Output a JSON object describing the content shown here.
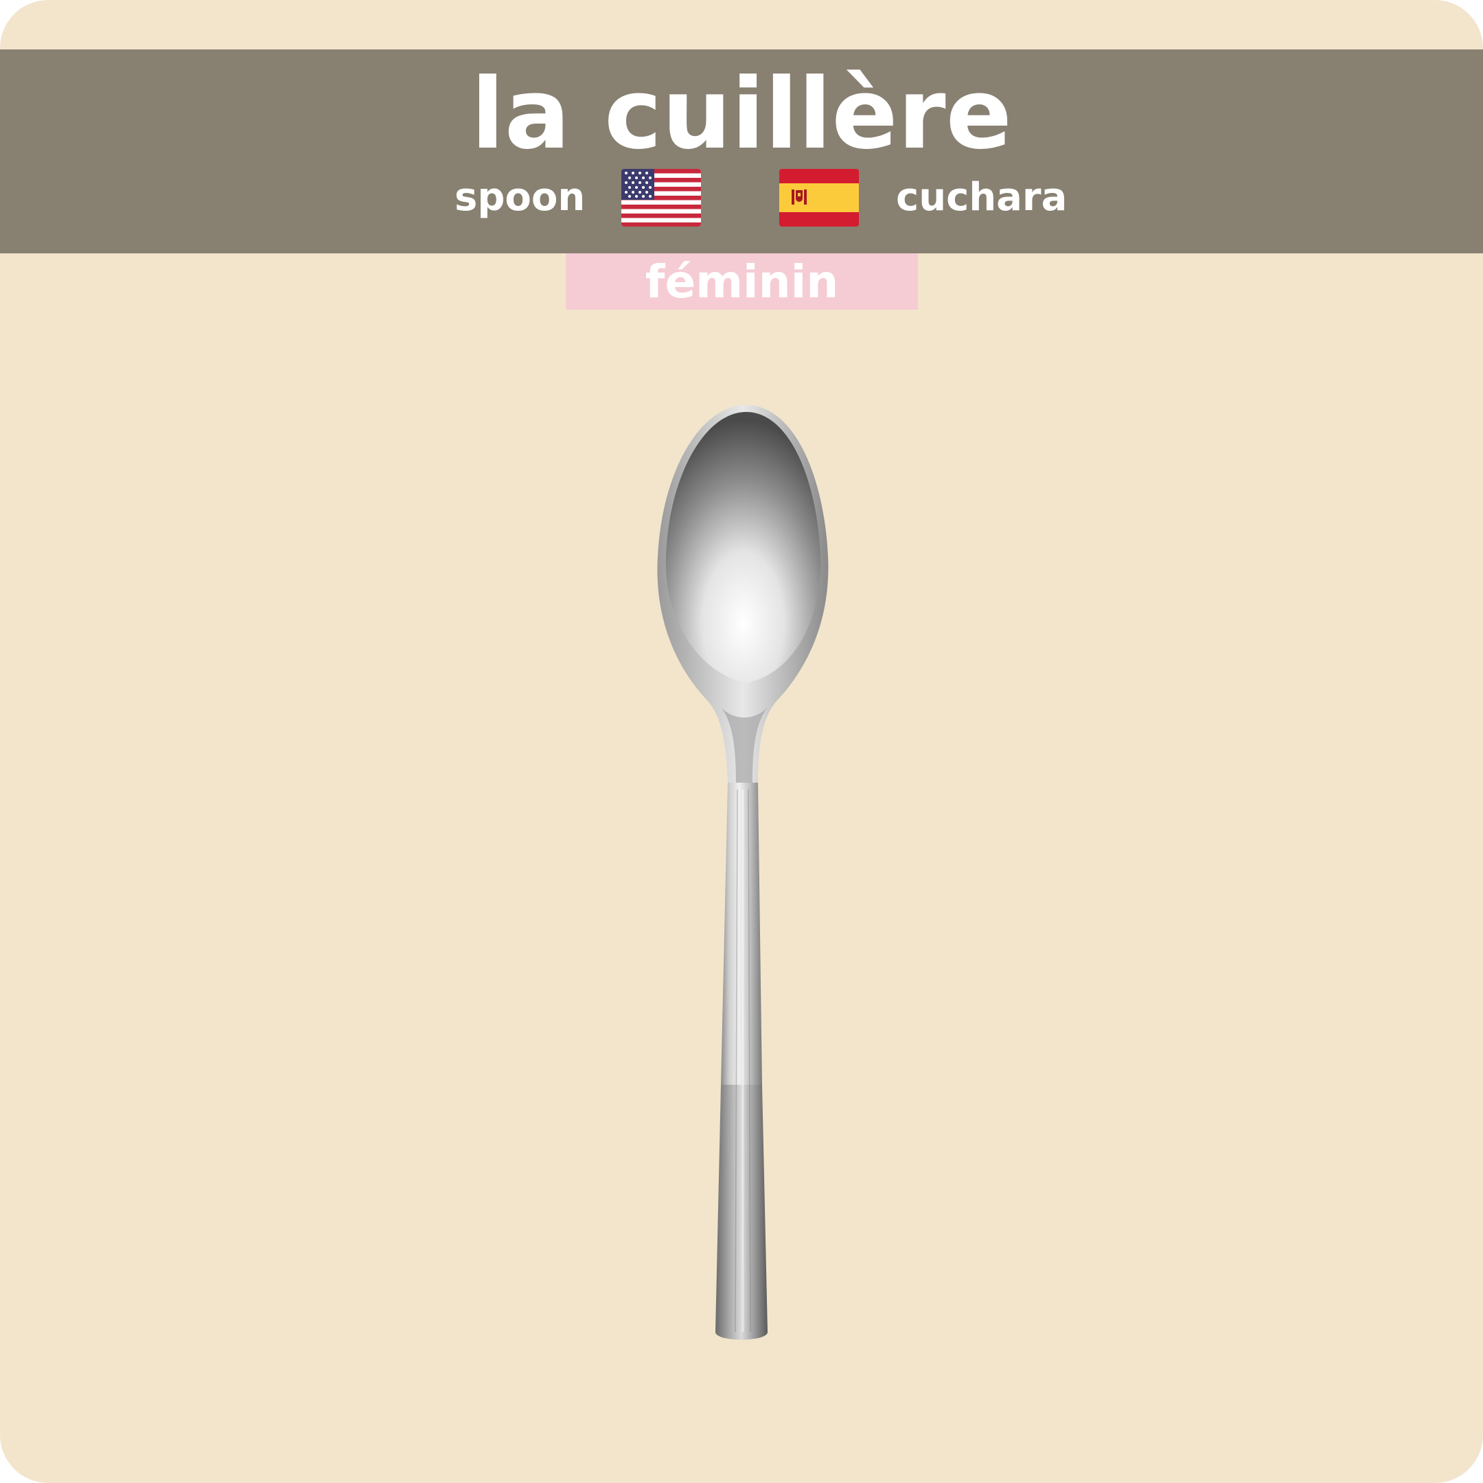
{
  "card": {
    "word": "la cuillère",
    "gender": "féminin",
    "translations": {
      "english": "spoon",
      "spanish": "cuchara"
    },
    "flags": {
      "english": "us-flag-icon",
      "spanish": "spain-flag-icon"
    },
    "illustration": "spoon-illustration"
  },
  "colors": {
    "background": "#f2e5cc",
    "header": "#888071",
    "gender_badge": "#f5ccd4",
    "text": "#ffffff"
  }
}
